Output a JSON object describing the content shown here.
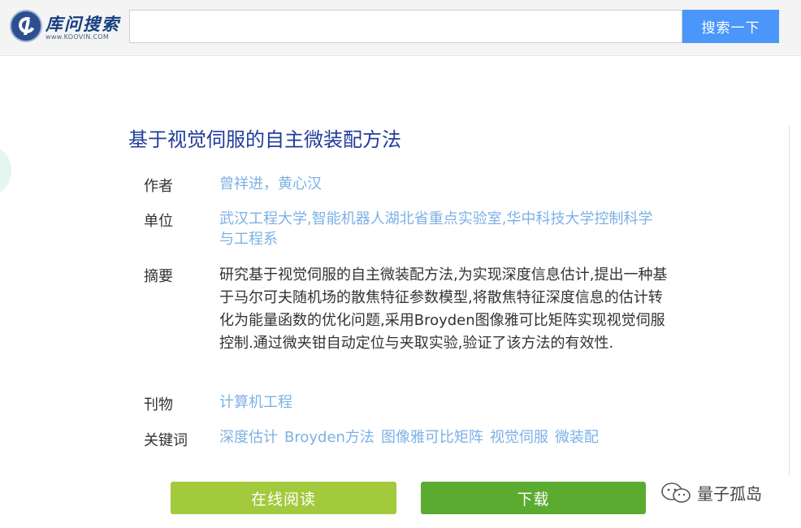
{
  "header": {
    "logo_title": "库问搜索",
    "logo_url": "www.KOOVIN.COM",
    "search": {
      "value": "",
      "placeholder": ""
    },
    "search_button": "搜索一下"
  },
  "article": {
    "title": "基于视觉伺服的自主微装配方法",
    "fields": {
      "author_label": "作者",
      "author_value": "曾祥进，黄心汉",
      "unit_label": "单位",
      "unit_value": "武汉工程大学,智能机器人湖北省重点实验室,华中科技大学控制科学与工程系",
      "abstract_label": "摘要",
      "abstract_value": "研究基于视觉伺服的自主微装配方法,为实现深度信息估计,提出一种基于马尔可夫随机场的散焦特征参数模型,将散焦特征深度信息的估计转化为能量函数的优化问题,采用Broyden图像雅可比矩阵实现视觉伺服控制.通过微夹钳自动定位与夹取实验,验证了该方法的有效性.",
      "journal_label": "刊物",
      "journal_value": "计算机工程",
      "keywords_label": "关键词",
      "keywords": [
        "深度估计",
        "Broyden方法",
        "图像雅可比矩阵",
        "视觉伺服",
        "微装配"
      ]
    }
  },
  "actions": {
    "read_online": "在线阅读",
    "download": "下载"
  },
  "watermark": {
    "text": "量子孤岛",
    "icon": "wechat-icon"
  },
  "colors": {
    "title": "#223d9b",
    "link": "#7cb1e6",
    "search_button": "#4a96fb",
    "read_button": "#a3c93c",
    "download_button": "#5aab30"
  }
}
